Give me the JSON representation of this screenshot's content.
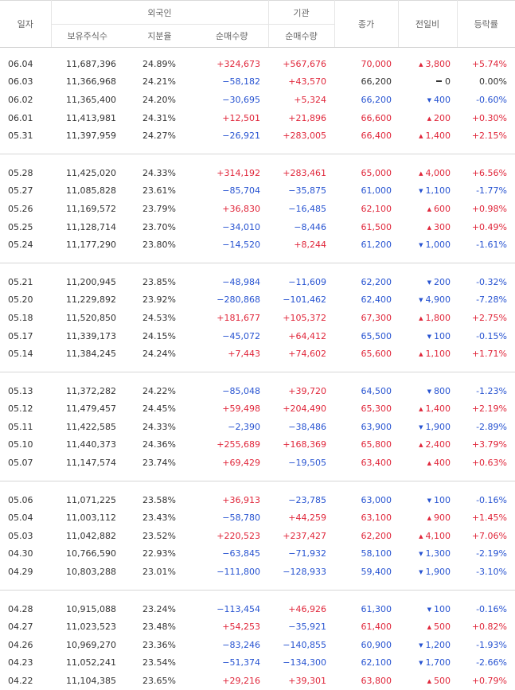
{
  "headers": {
    "date": "일자",
    "foreign": "외국인",
    "institution": "기관",
    "holdings": "보유주식수",
    "ratio": "지분율",
    "foreign_net": "순매수량",
    "inst_net": "순매수량",
    "close": "종가",
    "change": "전일비",
    "rate": "등락률"
  },
  "groups": [
    [
      {
        "date": "06.04",
        "hold": "11,687,396",
        "ratio": "24.89%",
        "fnet": "+324,673",
        "inet": "+567,676",
        "price": "70,000",
        "dir": "up",
        "chg": "3,800",
        "rate": "+5.74%"
      },
      {
        "date": "06.03",
        "hold": "11,366,968",
        "ratio": "24.21%",
        "fnet": "−58,182",
        "inet": "+43,570",
        "price": "66,200",
        "dir": "flat",
        "chg": "0",
        "rate": "0.00%"
      },
      {
        "date": "06.02",
        "hold": "11,365,400",
        "ratio": "24.20%",
        "fnet": "−30,695",
        "inet": "+5,324",
        "price": "66,200",
        "dir": "down",
        "chg": "400",
        "rate": "-0.60%"
      },
      {
        "date": "06.01",
        "hold": "11,413,981",
        "ratio": "24.31%",
        "fnet": "+12,501",
        "inet": "+21,896",
        "price": "66,600",
        "dir": "up",
        "chg": "200",
        "rate": "+0.30%"
      },
      {
        "date": "05.31",
        "hold": "11,397,959",
        "ratio": "24.27%",
        "fnet": "−26,921",
        "inet": "+283,005",
        "price": "66,400",
        "dir": "up",
        "chg": "1,400",
        "rate": "+2.15%"
      }
    ],
    [
      {
        "date": "05.28",
        "hold": "11,425,020",
        "ratio": "24.33%",
        "fnet": "+314,192",
        "inet": "+283,461",
        "price": "65,000",
        "dir": "up",
        "chg": "4,000",
        "rate": "+6.56%"
      },
      {
        "date": "05.27",
        "hold": "11,085,828",
        "ratio": "23.61%",
        "fnet": "−85,704",
        "inet": "−35,875",
        "price": "61,000",
        "dir": "down",
        "chg": "1,100",
        "rate": "-1.77%"
      },
      {
        "date": "05.26",
        "hold": "11,169,572",
        "ratio": "23.79%",
        "fnet": "+36,830",
        "inet": "−16,485",
        "price": "62,100",
        "dir": "up",
        "chg": "600",
        "rate": "+0.98%"
      },
      {
        "date": "05.25",
        "hold": "11,128,714",
        "ratio": "23.70%",
        "fnet": "−34,010",
        "inet": "−8,446",
        "price": "61,500",
        "dir": "up",
        "chg": "300",
        "rate": "+0.49%"
      },
      {
        "date": "05.24",
        "hold": "11,177,290",
        "ratio": "23.80%",
        "fnet": "−14,520",
        "inet": "+8,244",
        "price": "61,200",
        "dir": "down",
        "chg": "1,000",
        "rate": "-1.61%"
      }
    ],
    [
      {
        "date": "05.21",
        "hold": "11,200,945",
        "ratio": "23.85%",
        "fnet": "−48,984",
        "inet": "−11,609",
        "price": "62,200",
        "dir": "down",
        "chg": "200",
        "rate": "-0.32%"
      },
      {
        "date": "05.20",
        "hold": "11,229,892",
        "ratio": "23.92%",
        "fnet": "−280,868",
        "inet": "−101,462",
        "price": "62,400",
        "dir": "down",
        "chg": "4,900",
        "rate": "-7.28%"
      },
      {
        "date": "05.18",
        "hold": "11,520,850",
        "ratio": "24.53%",
        "fnet": "+181,677",
        "inet": "+105,372",
        "price": "67,300",
        "dir": "up",
        "chg": "1,800",
        "rate": "+2.75%"
      },
      {
        "date": "05.17",
        "hold": "11,339,173",
        "ratio": "24.15%",
        "fnet": "−45,072",
        "inet": "+64,412",
        "price": "65,500",
        "dir": "down",
        "chg": "100",
        "rate": "-0.15%"
      },
      {
        "date": "05.14",
        "hold": "11,384,245",
        "ratio": "24.24%",
        "fnet": "+7,443",
        "inet": "+74,602",
        "price": "65,600",
        "dir": "up",
        "chg": "1,100",
        "rate": "+1.71%"
      }
    ],
    [
      {
        "date": "05.13",
        "hold": "11,372,282",
        "ratio": "24.22%",
        "fnet": "−85,048",
        "inet": "+39,720",
        "price": "64,500",
        "dir": "down",
        "chg": "800",
        "rate": "-1.23%"
      },
      {
        "date": "05.12",
        "hold": "11,479,457",
        "ratio": "24.45%",
        "fnet": "+59,498",
        "inet": "+204,490",
        "price": "65,300",
        "dir": "up",
        "chg": "1,400",
        "rate": "+2.19%"
      },
      {
        "date": "05.11",
        "hold": "11,422,585",
        "ratio": "24.33%",
        "fnet": "−2,390",
        "inet": "−38,486",
        "price": "63,900",
        "dir": "down",
        "chg": "1,900",
        "rate": "-2.89%"
      },
      {
        "date": "05.10",
        "hold": "11,440,373",
        "ratio": "24.36%",
        "fnet": "+255,689",
        "inet": "+168,369",
        "price": "65,800",
        "dir": "up",
        "chg": "2,400",
        "rate": "+3.79%"
      },
      {
        "date": "05.07",
        "hold": "11,147,574",
        "ratio": "23.74%",
        "fnet": "+69,429",
        "inet": "−19,505",
        "price": "63,400",
        "dir": "up",
        "chg": "400",
        "rate": "+0.63%"
      }
    ],
    [
      {
        "date": "05.06",
        "hold": "11,071,225",
        "ratio": "23.58%",
        "fnet": "+36,913",
        "inet": "−23,785",
        "price": "63,000",
        "dir": "down",
        "chg": "100",
        "rate": "-0.16%"
      },
      {
        "date": "05.04",
        "hold": "11,003,112",
        "ratio": "23.43%",
        "fnet": "−58,780",
        "inet": "+44,259",
        "price": "63,100",
        "dir": "up",
        "chg": "900",
        "rate": "+1.45%"
      },
      {
        "date": "05.03",
        "hold": "11,042,882",
        "ratio": "23.52%",
        "fnet": "+220,523",
        "inet": "+237,427",
        "price": "62,200",
        "dir": "up",
        "chg": "4,100",
        "rate": "+7.06%"
      },
      {
        "date": "04.30",
        "hold": "10,766,590",
        "ratio": "22.93%",
        "fnet": "−63,845",
        "inet": "−71,932",
        "price": "58,100",
        "dir": "down",
        "chg": "1,300",
        "rate": "-2.19%"
      },
      {
        "date": "04.29",
        "hold": "10,803,288",
        "ratio": "23.01%",
        "fnet": "−111,800",
        "inet": "−128,933",
        "price": "59,400",
        "dir": "down",
        "chg": "1,900",
        "rate": "-3.10%"
      }
    ],
    [
      {
        "date": "04.28",
        "hold": "10,915,088",
        "ratio": "23.24%",
        "fnet": "−113,454",
        "inet": "+46,926",
        "price": "61,300",
        "dir": "down",
        "chg": "100",
        "rate": "-0.16%"
      },
      {
        "date": "04.27",
        "hold": "11,023,523",
        "ratio": "23.48%",
        "fnet": "+54,253",
        "inet": "−35,921",
        "price": "61,400",
        "dir": "up",
        "chg": "500",
        "rate": "+0.82%"
      },
      {
        "date": "04.26",
        "hold": "10,969,270",
        "ratio": "23.36%",
        "fnet": "−83,246",
        "inet": "−140,855",
        "price": "60,900",
        "dir": "down",
        "chg": "1,200",
        "rate": "-1.93%"
      },
      {
        "date": "04.23",
        "hold": "11,052,241",
        "ratio": "23.54%",
        "fnet": "−51,374",
        "inet": "−134,300",
        "price": "62,100",
        "dir": "down",
        "chg": "1,700",
        "rate": "-2.66%"
      },
      {
        "date": "04.22",
        "hold": "11,104,385",
        "ratio": "23.65%",
        "fnet": "+29,216",
        "inet": "+39,301",
        "price": "63,800",
        "dir": "up",
        "chg": "500",
        "rate": "+0.79%"
      }
    ]
  ],
  "colors": {
    "up": "#e0263a",
    "down": "#2753d1",
    "flat": "#333333"
  },
  "icons": {
    "up": "triangle-up-icon",
    "down": "triangle-down-icon",
    "flat": "dash-icon"
  }
}
